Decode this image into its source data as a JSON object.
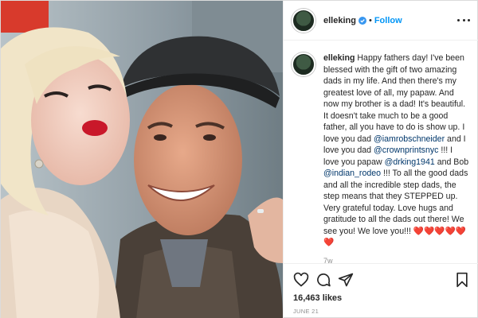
{
  "post": {
    "username": "elleking",
    "follow_label": "Follow",
    "separator": "•",
    "caption": {
      "username": "elleking",
      "p1": "Happy fathers day! I've been blessed with the gift of two amazing dads in my life. And then there's my greatest love of all, my papaw. And now my brother is a dad! It's beautiful. It doesn't take much to be a good father, all you have to do is show up. I love you dad ",
      "m1": "@iamrobschneider",
      "p2": " and I love you dad ",
      "m2": "@crownprintsnyc",
      "p3": " !!! I love you papaw ",
      "m3": "@drking1941",
      "p4": " and Bob ",
      "m4": "@indian_rodeo",
      "p5": " !!! To all the good dads and all the incredible step dads, the step means that they STEPPED up. Very grateful today. Love hugs and gratitude to all the dads out there! We see you! We love you!!! ",
      "hearts": "❤️❤️❤️❤️❤️❤️"
    },
    "time_ago": "7w",
    "likes": "16,463 likes",
    "date": "JUNE 21"
  },
  "icons": {
    "verified": "verified-badge-icon",
    "more": "more-options-icon",
    "like": "heart-icon",
    "comment": "comment-icon",
    "share": "share-icon",
    "save": "bookmark-icon"
  },
  "colors": {
    "link_blue": "#0095f6",
    "mention": "#00376b",
    "text": "#262626",
    "muted": "#8e8e8e",
    "divider": "#efefef"
  }
}
